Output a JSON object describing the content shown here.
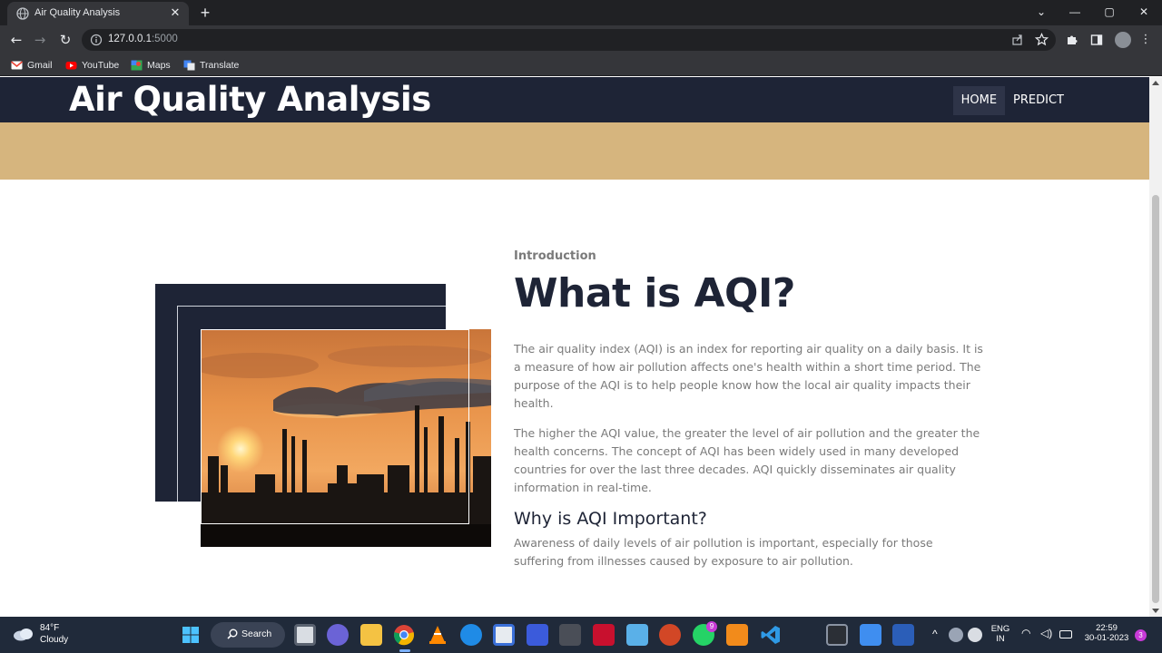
{
  "browser": {
    "tab_title": "Air Quality Analysis",
    "tab_close": "✕",
    "new_tab": "+",
    "url_host": "127.0.0.1",
    "url_port": ":5000",
    "bookmarks": [
      "Gmail",
      "YouTube",
      "Maps",
      "Translate"
    ]
  },
  "site": {
    "title": "Air Quality Analysis",
    "nav": [
      {
        "label": "HOME",
        "active": true
      },
      {
        "label": "PREDICT",
        "active": false
      }
    ],
    "banner_color": "#d6b57e",
    "header_color": "#1e2436"
  },
  "intro": {
    "eyebrow": "Introduction",
    "heading": "What is AQI?",
    "para1": "The air quality index (AQI) is an index for reporting air quality on a daily basis. It is a measure of how air pollution affects one's health within a short time period. The purpose of the AQI is to help people know how the local air quality impacts their health.",
    "para2": "The higher the AQI value, the greater the level of air pollution and the greater the health concerns. The concept of AQI has been widely used in many developed countries for over the last three decades. AQI quickly disseminates air quality information in real-time.",
    "subheading": "Why is AQI Important?",
    "para3": "Awareness of daily levels of air pollution is important, especially for those suffering from illnesses caused by exposure to air pollution.",
    "image": "industrial-smokestacks-sunset-photo"
  },
  "taskbar": {
    "weather_temp": "84°F",
    "weather_cond": "Cloudy",
    "search_label": "Search",
    "whatsapp_badge": "9",
    "lang_line1": "ENG",
    "lang_line2": "IN",
    "time": "22:59",
    "date": "30-01-2023",
    "notif_count": "3"
  }
}
